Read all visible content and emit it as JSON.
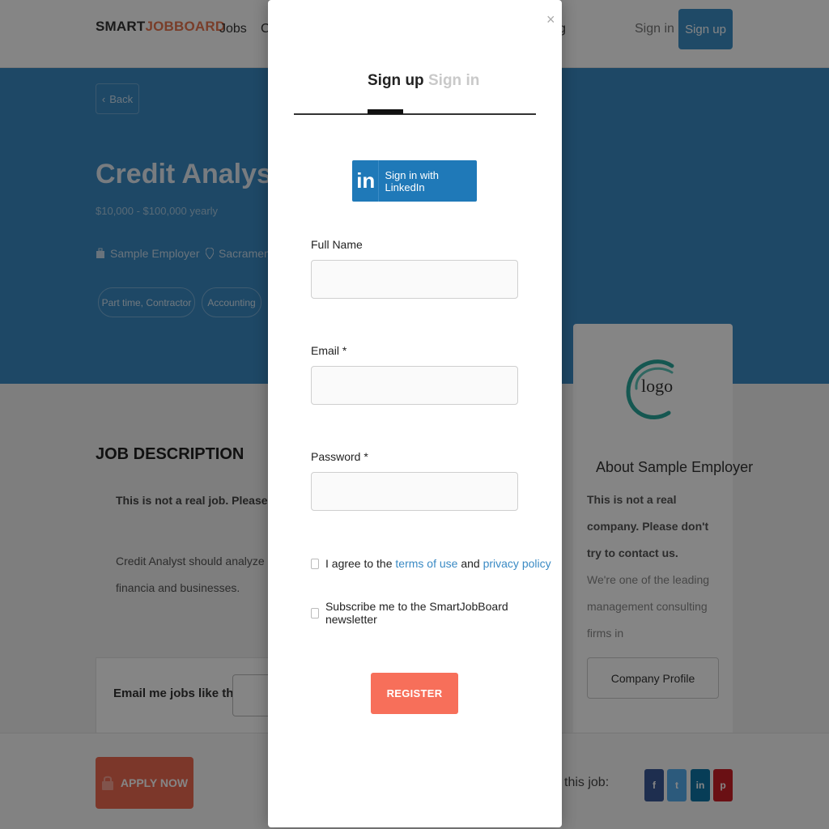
{
  "nav": {
    "brand_part1": "SMART",
    "brand_part2": "JOBBOARD",
    "jobs_link": "Jobs",
    "companies_link_partial": "C",
    "blog_link_partial": "g",
    "signin": "Sign in",
    "signup": "Sign up"
  },
  "job": {
    "back_label": "Back",
    "title": "Credit Analyst",
    "salary": "$10,000 - $100,000 yearly",
    "employer": "Sample Employer",
    "location": "Sacramento, C",
    "tags": [
      "Part time,  Contractor",
      "Accounting"
    ]
  },
  "description": {
    "section_title": "JOB DESCRIPTION",
    "line1": "This is not a real job. Please don't app",
    "line2": "Credit Analyst should analyze financia and businesses."
  },
  "email_alert": {
    "label": "Email me jobs like this"
  },
  "employer_card": {
    "logo_text": "logo",
    "title": "About Sample Employer",
    "text": "This is not a real company. Please don't try to contact us.",
    "more": "We're one of the leading management consulting firms in",
    "profile_button": "Company Profile"
  },
  "bottom_bar": {
    "apply_button": "APPLY NOW",
    "share_label": "this job:",
    "share_buttons": [
      {
        "icon": "facebook-icon",
        "glyph": "f",
        "color": "#3b5998"
      },
      {
        "icon": "twitter-icon",
        "glyph": "t",
        "color": "#55acee"
      },
      {
        "icon": "linkedin-icon",
        "glyph": "in",
        "color": "#0e76a8"
      },
      {
        "icon": "pinterest-icon",
        "glyph": "p",
        "color": "#cb2027"
      }
    ]
  },
  "modal": {
    "close_glyph": "×",
    "tab_signup": "Sign up",
    "tab_signin": "Sign in",
    "linkedin_logo": "in",
    "linkedin_button": "Sign in with LinkedIn",
    "full_name_label": "Full Name",
    "full_name_value": "",
    "email_label": "Email *",
    "email_value": "",
    "password_label": "Password *",
    "password_value": "",
    "agree_prefix": "I agree to the",
    "terms_link": "terms of use",
    "agree_and": "and",
    "privacy_link": "privacy policy",
    "subscribe_label": "Subscribe me to the SmartJobBoard newsletter",
    "register_button": "REGISTER"
  },
  "colors": {
    "hero": "#3a8ac4",
    "accent": "#f76f5a",
    "linkedin": "#1f79b8"
  }
}
